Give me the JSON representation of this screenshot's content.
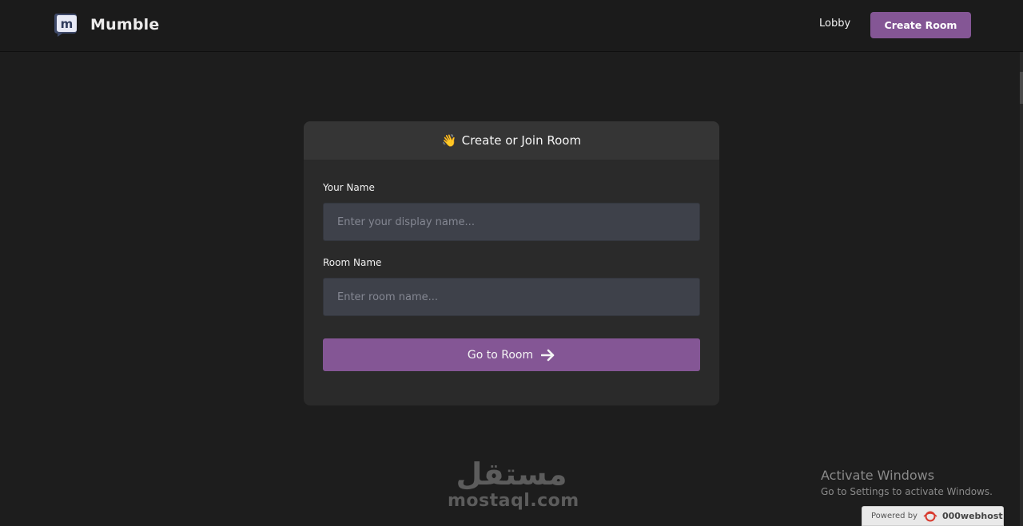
{
  "header": {
    "brand_name": "Mumble",
    "logo_letter": "m",
    "nav_lobby": "Lobby",
    "nav_create_room": "Create Room"
  },
  "card": {
    "title_emoji": "👋",
    "title": "Create or Join Room",
    "name_label": "Your Name",
    "name_value": "",
    "name_placeholder": "Enter your display name...",
    "room_label": "Room Name",
    "room_value": "",
    "room_placeholder": "Enter room name...",
    "submit_label": "Go to Room"
  },
  "watermark": {
    "arabic": "مستقل",
    "latin": "mostaql.com"
  },
  "windows_notice": {
    "title": "Activate Windows",
    "subtitle": "Go to Settings to activate Windows."
  },
  "powered": {
    "prefix": "Powered by",
    "host": "000webhost"
  },
  "colors": {
    "background": "#1d1d1d",
    "accent": "#845695",
    "card": "#2a2a2a",
    "input": "#3e414a"
  },
  "icons": {
    "logo": "mumble-logo-icon",
    "arrow": "arrow-right-icon",
    "webhost": "webhost-logo-icon"
  }
}
